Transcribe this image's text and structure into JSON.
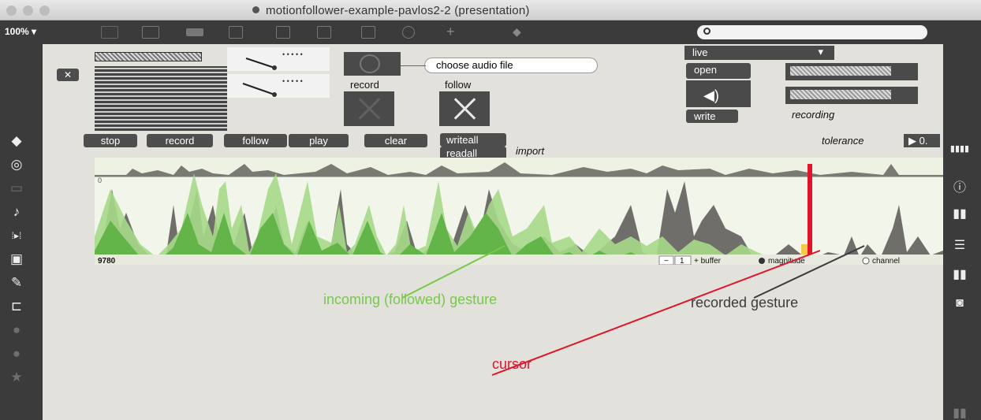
{
  "window": {
    "title": "motionfollower-example-pavlos2-2 (presentation)"
  },
  "toolbar": {
    "zoom": "100% ▾"
  },
  "patch": {
    "close_x": "✕",
    "choose_audio_label": "choose audio file",
    "record_label": "record",
    "follow_label": "follow",
    "buttons": {
      "stop": "stop",
      "record": "record",
      "follow": "follow",
      "play": "play",
      "clear": "clear",
      "writeall": "writeall",
      "readall": "readall"
    },
    "import_label": "import",
    "live_menu": "live",
    "open_button": "open",
    "write_button": "write",
    "recording_label": "recording",
    "tolerance_label": "tolerance",
    "tolerance_value": "▶ 0.",
    "waveform": {
      "zero_label": "0",
      "sample_count": "9780",
      "minus_button": "−",
      "buffer_index": "1",
      "plus_buffer": "+ buffer",
      "magnitude_option": "magnitude",
      "channel_option": "channel"
    }
  },
  "annotations": {
    "incoming": "incoming (followed) gesture",
    "recorded": "recorded gesture",
    "cursor": "cursor"
  },
  "colors": {
    "incoming": "#78c84a",
    "recorded": "#3d3b3a",
    "cursor": "#e0142a",
    "panel_bg": "#e3e1dc",
    "dark_bar": "#3b3b3b"
  }
}
